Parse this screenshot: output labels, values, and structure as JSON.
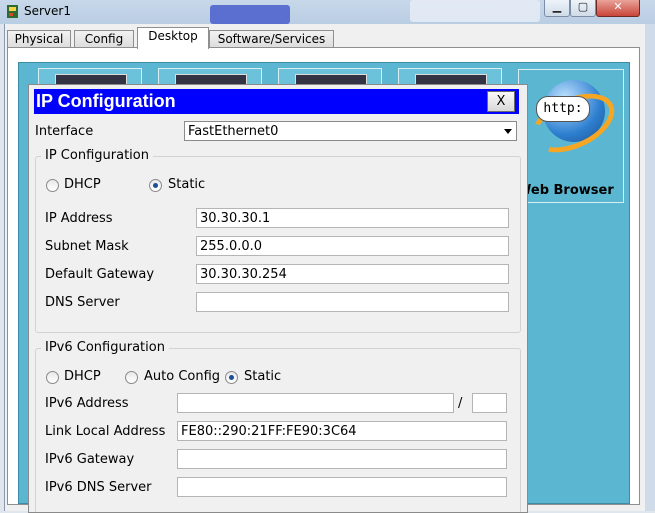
{
  "window": {
    "title": "Server1"
  },
  "tabs": [
    {
      "label": "Physical"
    },
    {
      "label": "Config"
    },
    {
      "label": "Desktop",
      "active": true
    },
    {
      "label": "Software/Services"
    }
  ],
  "desktop": {
    "web_browser": {
      "label": "Web Browser",
      "bubble": "http:"
    }
  },
  "dialog": {
    "title": "IP Configuration",
    "close_label": "X",
    "interface_label": "Interface",
    "interface_value": "FastEthernet0",
    "ipv4": {
      "group_title": "IP Configuration",
      "dhcp_label": "DHCP",
      "static_label": "Static",
      "selected_mode": "Static",
      "ip_address_label": "IP Address",
      "ip_address": "30.30.30.1",
      "subnet_mask_label": "Subnet Mask",
      "subnet_mask": "255.0.0.0",
      "gateway_label": "Default Gateway",
      "gateway": "30.30.30.254",
      "dns_label": "DNS Server",
      "dns": ""
    },
    "ipv6": {
      "group_title": "IPv6 Configuration",
      "dhcp_label": "DHCP",
      "auto_label": "Auto Config",
      "static_label": "Static",
      "selected_mode": "Static",
      "address_label": "IPv6 Address",
      "address": "",
      "slash": "/",
      "prefix": "",
      "link_local_label": "Link Local Address",
      "link_local": "FE80::290:21FF:FE90:3C64",
      "gateway_label": "IPv6 Gateway",
      "gateway": "",
      "dns_label": "IPv6 DNS Server",
      "dns": ""
    }
  }
}
